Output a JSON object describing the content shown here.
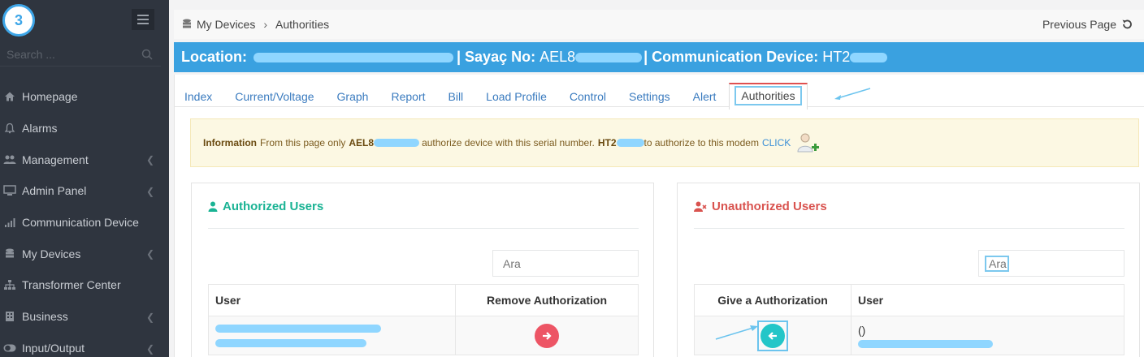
{
  "sidebar": {
    "badge": "3",
    "search_placeholder": "Search ...",
    "items": [
      {
        "label": "Homepage",
        "icon": "home-icon",
        "chevron": false
      },
      {
        "label": "Alarms",
        "icon": "bell-icon",
        "chevron": false
      },
      {
        "label": "Management",
        "icon": "users-icon",
        "chevron": true
      },
      {
        "label": "Admin Panel",
        "icon": "monitor-icon",
        "chevron": true
      },
      {
        "label": "Communication Device",
        "icon": "signal-icon",
        "chevron": false
      },
      {
        "label": "My Devices",
        "icon": "database-icon",
        "chevron": true
      },
      {
        "label": "Transformer Center",
        "icon": "sitemap-icon",
        "chevron": false
      },
      {
        "label": "Business",
        "icon": "building-icon",
        "chevron": true
      },
      {
        "label": "Input/Output",
        "icon": "toggle-icon",
        "chevron": true
      }
    ]
  },
  "breadcrumb": {
    "root": "My Devices",
    "current": "Authorities"
  },
  "previous_page": "Previous Page",
  "location_bar": {
    "location_label": "Location:",
    "sayac_label": "| Sayaç No:",
    "sayac_value": "AEL8",
    "comm_label": "| Communication Device:",
    "comm_value": "HT2"
  },
  "tabs": [
    "Index",
    "Current/Voltage",
    "Graph",
    "Report",
    "Bill",
    "Load Profile",
    "Control",
    "Settings",
    "Alert",
    "Authorities"
  ],
  "active_tab": "Authorities",
  "info": {
    "title": "Information",
    "text1": "From this page only",
    "serial1": "AEL8",
    "text2": "authorize device with this serial number.",
    "serial2": "HT2",
    "text3": "to authorize to this modem",
    "link": "CLICK"
  },
  "authorized": {
    "title": "Authorized Users",
    "search_placeholder": "Ara",
    "col_user": "User",
    "col_action": "Remove Authorization"
  },
  "unauthorized": {
    "title": "Unauthorized Users",
    "search_placeholder": "Ara",
    "col_action": "Give a Authorization",
    "col_user": "User",
    "row_user": "()"
  },
  "colors": {
    "sidebar": "#2f353f",
    "accent": "#3aa1e0",
    "green": "#1ab394",
    "red": "#d9534f",
    "remove_btn": "#ed5565",
    "give_btn": "#23c6c8"
  }
}
